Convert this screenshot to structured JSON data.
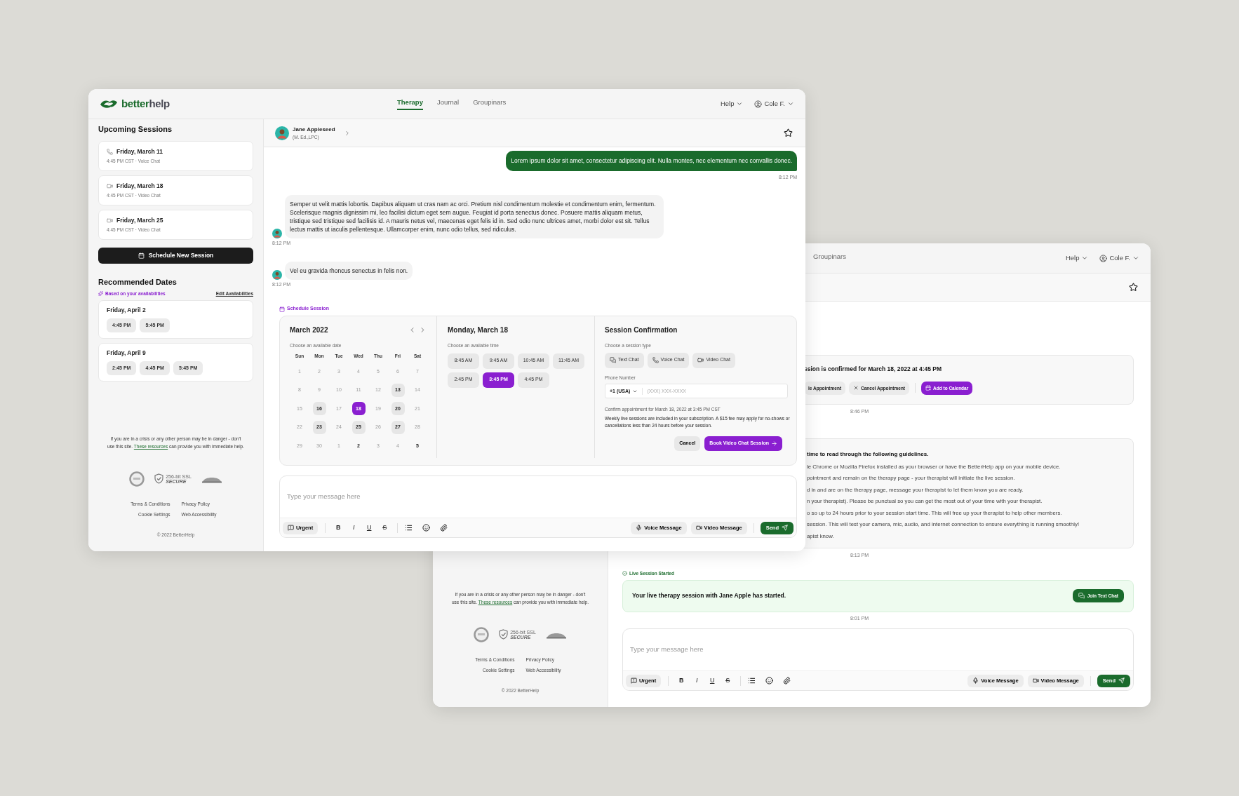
{
  "back_window": {
    "nav_tabs": [
      {
        "label": "Groupinars",
        "selected": false
      }
    ],
    "help_menu": "Help",
    "user_menu": "Cole F.",
    "confirmation_card": {
      "text": "ssion is confirmed for March 18, 2022 at 4:45 PM",
      "actions": [
        {
          "kind": "reschedule",
          "label": "le Appointment"
        },
        {
          "kind": "cancel",
          "label": "Cancel Appointment"
        },
        {
          "kind": "calendar",
          "label": "Add to Calendar"
        }
      ],
      "time": "8:46 PM"
    },
    "guidelines": {
      "title": "time to read through the following guidelines.",
      "lines": [
        "le Chrome or Mozilla Firefox installed as your browser or have the BetterHelp app on your mobile device.",
        "pointment and remain on the therapy page - your therapist will initiate the live session.",
        "d in and are on the therapy page, message your therapist to let them know you are ready.",
        "n your therapist). Please be punctual so you can get the most out of your time with your therapist.",
        "o so up to 24 hours prior to your session start time. This will free up your therapist to help other members.",
        "session. This will test your camera, mic, audio, and internet connection to ensure everything is running smoothly!",
        "apist know."
      ],
      "time": "8:13 PM"
    },
    "live_session": {
      "label": "Live Session Started",
      "text": "Your live therapy session with Jane Apple has started.",
      "button": "Join Text Chat",
      "time": "8:01 PM"
    },
    "composer": {
      "placeholder": "Type your message here",
      "urgent": "Urgent",
      "format_buttons": [
        {
          "kind": "bold",
          "label": "B"
        },
        {
          "kind": "italic",
          "label": "I"
        },
        {
          "kind": "underline",
          "label": "U"
        },
        {
          "kind": "strike",
          "label": "S"
        }
      ],
      "voice_message": "Voice Message",
      "video_message": "Video Message",
      "send": "Send"
    },
    "footer": {
      "crisis_before": "If you are in a crisis or any other person may be in danger - don't use this site.",
      "crisis_link": "These resources",
      "crisis_after": "can provide you with immediate help.",
      "ssl_top": "256-bit SSL",
      "ssl_bottom": "SECURE",
      "links": [
        "Terms & Conditions",
        "Privacy Policy",
        "Cookie Settings",
        "Web Accessibility"
      ],
      "copyright": "© 2022 BetterHelp"
    }
  },
  "front_window": {
    "logo": {
      "primary": "better",
      "secondary": "help"
    },
    "nav_tabs": [
      {
        "label": "Therapy",
        "selected": true
      },
      {
        "label": "Journal",
        "selected": false
      },
      {
        "label": "Groupinars",
        "selected": false
      }
    ],
    "help_menu": "Help",
    "user_menu": "Cole F.",
    "sidebar": {
      "upcoming_title": "Upcoming Sessions",
      "sessions": [
        {
          "kind": "voice",
          "date": "Friday, March 11",
          "detail": "4:45 PM CST · Voice Chat"
        },
        {
          "kind": "video",
          "date": "Friday, March 18",
          "detail": "4:45 PM CST · Video Chat"
        },
        {
          "kind": "video",
          "date": "Friday, March 25",
          "detail": "4:45 PM CST · Video Chat"
        }
      ],
      "schedule_button": "Schedule New Session",
      "recommended_title": "Recommended Dates",
      "recommended_hint": "Based on your availabilities",
      "edit_link": "Edit Availabilities",
      "recommended": [
        {
          "date": "Friday, April 2",
          "times": [
            "4:45 PM",
            "5:45 PM"
          ]
        },
        {
          "date": "Friday, April 9",
          "times": [
            "2:45 PM",
            "4:45 PM",
            "5:45 PM"
          ]
        }
      ]
    },
    "footer": {
      "crisis_before": "If you are in a crisis or any other person may be in danger - don't use this site.",
      "crisis_link": "These resources",
      "crisis_after": "can provide you with immediate help.",
      "ssl_top": "256-bit SSL",
      "ssl_bottom": "SECURE",
      "links": [
        "Terms & Conditions",
        "Privacy Policy",
        "Cookie Settings",
        "Web Accessibility"
      ],
      "copyright": "© 2022 BetterHelp"
    },
    "therapist": {
      "name": "Jane Appleseed",
      "credentials": "(M. Ed.,LPC)"
    },
    "messages": [
      {
        "kind": "sent",
        "text": "Lorem ipsum dolor sit amet, consectetur adipiscing elit. Nulla montes, nec elementum nec convallis donec.",
        "time": "8:12 PM"
      },
      {
        "kind": "received",
        "text": "Semper ut velit mattis lobortis. Dapibus aliquam ut cras nam ac orci. Pretium nisl condimentum molestie et condimentum enim, fermentum. Scelerisque magnis dignissim mi, leo facilisi dictum eget sem augue. Feugiat id porta senectus donec. Posuere mattis aliquam metus, tristique sed tristique sed facilisis id. A mauris netus vel, maecenas eget felis id in. Sed odio nunc ultrices amet, morbi dolor est sit. Tellus lectus mattis ut iaculis pellentesque. Ullamcorper enim, nunc odio tellus, sed ridiculus.",
        "time": "8:12 PM"
      },
      {
        "kind": "received",
        "text": "Vel eu gravida rhoncus senectus in felis non.",
        "time": "8:12 PM"
      }
    ],
    "scheduler": {
      "label": "Schedule Session",
      "month": "March 2022",
      "date_hint": "Choose an available date",
      "weekdays": [
        "Sun",
        "Mon",
        "Tue",
        "Wed",
        "Thu",
        "Fri",
        "Sat"
      ],
      "days": [
        {
          "day": "1",
          "kind": "muted",
          "selected": false
        },
        {
          "day": "2",
          "kind": "muted",
          "selected": false
        },
        {
          "day": "3",
          "kind": "muted",
          "selected": false
        },
        {
          "day": "4",
          "kind": "muted",
          "selected": false
        },
        {
          "day": "5",
          "kind": "muted",
          "selected": false
        },
        {
          "day": "6",
          "kind": "muted",
          "selected": false
        },
        {
          "day": "7",
          "kind": "muted",
          "selected": false
        },
        {
          "day": "8",
          "kind": "muted",
          "selected": false
        },
        {
          "day": "9",
          "kind": "muted",
          "selected": false
        },
        {
          "day": "10",
          "kind": "muted",
          "selected": false
        },
        {
          "day": "11",
          "kind": "muted",
          "selected": false
        },
        {
          "day": "12",
          "kind": "muted",
          "selected": false
        },
        {
          "day": "13",
          "kind": "available",
          "selected": false
        },
        {
          "day": "14",
          "kind": "muted",
          "selected": false
        },
        {
          "day": "15",
          "kind": "muted",
          "selected": false
        },
        {
          "day": "16",
          "kind": "available",
          "selected": false
        },
        {
          "day": "17",
          "kind": "muted",
          "selected": false
        },
        {
          "day": "18",
          "kind": "available",
          "selected": true
        },
        {
          "day": "19",
          "kind": "muted",
          "selected": false
        },
        {
          "day": "20",
          "kind": "available",
          "selected": false
        },
        {
          "day": "21",
          "kind": "muted",
          "selected": false
        },
        {
          "day": "22",
          "kind": "muted",
          "selected": false
        },
        {
          "day": "23",
          "kind": "available",
          "selected": false
        },
        {
          "day": "24",
          "kind": "muted",
          "selected": false
        },
        {
          "day": "25",
          "kind": "available",
          "selected": false
        },
        {
          "day": "26",
          "kind": "muted",
          "selected": false
        },
        {
          "day": "27",
          "kind": "available",
          "selected": false
        },
        {
          "day": "28",
          "kind": "muted",
          "selected": false
        },
        {
          "day": "29",
          "kind": "muted",
          "selected": false
        },
        {
          "day": "30",
          "kind": "muted",
          "selected": false
        },
        {
          "day": "1",
          "kind": "muted",
          "selected": false
        },
        {
          "day": "2",
          "kind": "plain",
          "selected": false
        },
        {
          "day": "3",
          "kind": "muted",
          "selected": false
        },
        {
          "day": "4",
          "kind": "muted",
          "selected": false
        },
        {
          "day": "5",
          "kind": "plain",
          "selected": false
        }
      ],
      "day_title": "Monday, March 18",
      "time_hint": "Choose an available time",
      "times": [
        {
          "label": "8:45 AM",
          "selected": false
        },
        {
          "label": "9:45 AM",
          "selected": false
        },
        {
          "label": "10:45 AM",
          "selected": false
        },
        {
          "label": "11:45 AM",
          "selected": false
        },
        {
          "label": "2:45 PM",
          "selected": false
        },
        {
          "label": "3:45 PM",
          "selected": true
        },
        {
          "label": "4:45 PM",
          "selected": false
        }
      ],
      "confirmation_title": "Session Confirmation",
      "type_hint": "Choose a session type",
      "session_types": [
        {
          "kind": "text",
          "label": "Text Chat"
        },
        {
          "kind": "voice",
          "label": "Voice Chat"
        },
        {
          "kind": "video",
          "label": "Video Chat"
        }
      ],
      "phone_label": "Phone Number",
      "country_code": "+1 (USA)",
      "phone_placeholder": "(XXX) XXX-XXXX",
      "confirm_text": "Confirm appointment for March 18, 2022 at 3:45 PM CST",
      "fee_note": "Weekly live sessions are included in your subscription. A $15 fee may apply for no-shows or cancellations less than 24 hours before your session.",
      "cancel": "Cancel",
      "book": "Book Video Chat Session"
    },
    "composer": {
      "placeholder": "Type your message here",
      "urgent": "Urgent",
      "format_buttons": [
        {
          "kind": "bold",
          "label": "B"
        },
        {
          "kind": "italic",
          "label": "I"
        },
        {
          "kind": "underline",
          "label": "U"
        },
        {
          "kind": "strike",
          "label": "S"
        }
      ],
      "voice_message": "Voice Message",
      "video_message": "Video Message",
      "send": "Send"
    }
  }
}
